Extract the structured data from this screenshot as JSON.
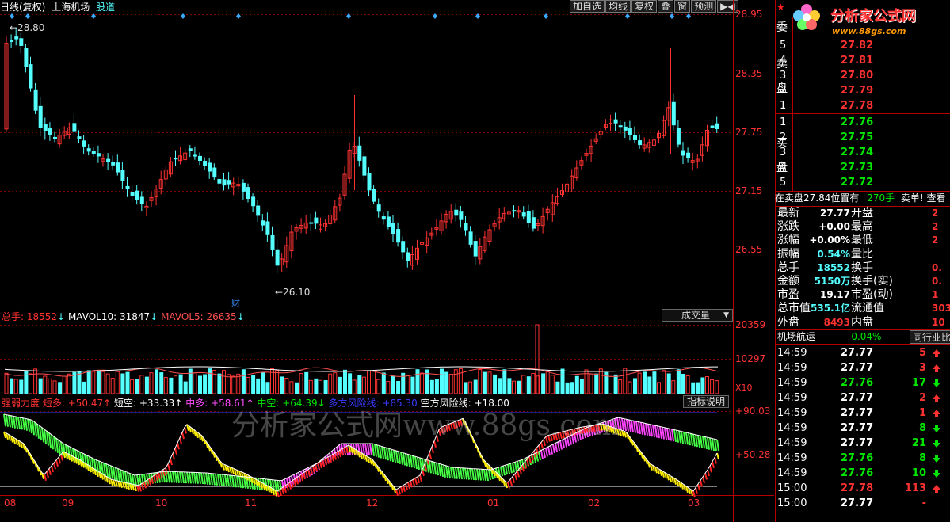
{
  "title": {
    "period": "日线(复权)",
    "stock": "上海机场",
    "link": "股道"
  },
  "toolbar": [
    "加自选",
    "均线",
    "复权",
    "叠",
    "窗",
    "预测"
  ],
  "price_chart": {
    "ticks": [
      "28.95",
      "28.35",
      "27.75",
      "27.15",
      "26.55"
    ],
    "high_label": "←28.80",
    "low_label": "←26.10",
    "fin_badge": "财"
  },
  "volume": {
    "label_total": "总手: ",
    "total": "18552",
    "label_mav10": "MAVOL10: ",
    "mav10": "31847",
    "label_mav5": "MAVOL5: ",
    "mav5": "26635",
    "arrow": "↓",
    "dropdown": "成交量",
    "ticks": [
      "20359",
      "10297"
    ],
    "unit": "X10"
  },
  "indicator": {
    "name": "强弱力度",
    "items": [
      {
        "label": "短多: ",
        "value": "+50.47",
        "arrow": "↑"
      },
      {
        "label": "短空: ",
        "value": "+33.33",
        "arrow": "↑"
      },
      {
        "label": "中多: ",
        "value": "+58.61",
        "arrow": "↑"
      },
      {
        "label": "中空: ",
        "value": "+64.39",
        "arrow": "↓"
      },
      {
        "label": "多方风险线: ",
        "value": "+85.30",
        "arrow": ""
      },
      {
        "label": "空方风险线: ",
        "value": "+18.00",
        "arrow": ""
      }
    ],
    "explain_btn": "指标说明",
    "ticks": [
      "+90.03",
      "+50.28"
    ]
  },
  "x_axis": [
    "08",
    "09",
    "10",
    "11",
    "12",
    "01",
    "02",
    "03"
  ],
  "watermark": "分析家公式网www.88gs.com",
  "logo": {
    "title": "分析家公式网",
    "url": "www.88gs.com"
  },
  "order_book": {
    "wei_label": "委",
    "sell_label": [
      "卖",
      "盘"
    ],
    "buy_label": [
      "买",
      "盘"
    ],
    "sell": [
      {
        "level": "5",
        "price": "27.82"
      },
      {
        "level": "4",
        "price": "27.81"
      },
      {
        "level": "3",
        "price": "27.80"
      },
      {
        "level": "2",
        "price": "27.79"
      },
      {
        "level": "1",
        "price": "27.78"
      }
    ],
    "buy": [
      {
        "level": "1",
        "price": "27.76"
      },
      {
        "level": "2",
        "price": "27.75"
      },
      {
        "level": "3",
        "price": "27.74"
      },
      {
        "level": "4",
        "price": "27.73"
      },
      {
        "level": "5",
        "price": "27.72"
      }
    ],
    "status_a": "在卖盘27.84位置有",
    "status_b": "270手",
    "status_c": "卖单! 查看"
  },
  "quote": [
    {
      "l": "最新",
      "v": "27.77",
      "l2": "开盘",
      "v2": "2"
    },
    {
      "l": "涨跌",
      "v": "+0.00",
      "l2": "最高",
      "v2": "2"
    },
    {
      "l": "涨幅",
      "v": "+0.00%",
      "l2": "最低",
      "v2": "2"
    },
    {
      "l": "振幅",
      "v": "0.54%",
      "l2": "量比",
      "v2": ""
    },
    {
      "l": "总手",
      "v": "18552",
      "l2": "换手",
      "v2": "0."
    },
    {
      "l": "金额",
      "v": "5150万",
      "l2": "换手(实)",
      "v2": "0."
    },
    {
      "l": "市盈",
      "v": "19.17",
      "l2": "市盈(动)",
      "v2": "1"
    },
    {
      "l": "总市值",
      "v": "535.1亿",
      "l2": "流通值",
      "v2": "303"
    },
    {
      "l": "外盘",
      "v": "8493",
      "l2": "内盘",
      "v2": "10"
    }
  ],
  "sector": {
    "name": "机场航运",
    "change": "-0.04%",
    "tab": "同行业比"
  },
  "ticks": [
    {
      "t": "14:59",
      "p": "27.77",
      "v": "5",
      "dir": "up"
    },
    {
      "t": "14:59",
      "p": "27.77",
      "v": "3",
      "dir": "up"
    },
    {
      "t": "14:59",
      "p": "27.76",
      "v": "17",
      "dir": "down"
    },
    {
      "t": "14:59",
      "p": "27.77",
      "v": "2",
      "dir": "up"
    },
    {
      "t": "14:59",
      "p": "27.77",
      "v": "1",
      "dir": "up"
    },
    {
      "t": "14:59",
      "p": "27.77",
      "v": "8",
      "dir": "down"
    },
    {
      "t": "14:59",
      "p": "27.77",
      "v": "21",
      "dir": "down"
    },
    {
      "t": "14:59",
      "p": "27.76",
      "v": "8",
      "dir": "down"
    },
    {
      "t": "14:59",
      "p": "27.76",
      "v": "10",
      "dir": "down"
    },
    {
      "t": "15:00",
      "p": "27.78",
      "v": "113",
      "dir": "up"
    },
    {
      "t": "15:00",
      "p": "27.77",
      "v": "-",
      "dir": "none"
    }
  ]
}
